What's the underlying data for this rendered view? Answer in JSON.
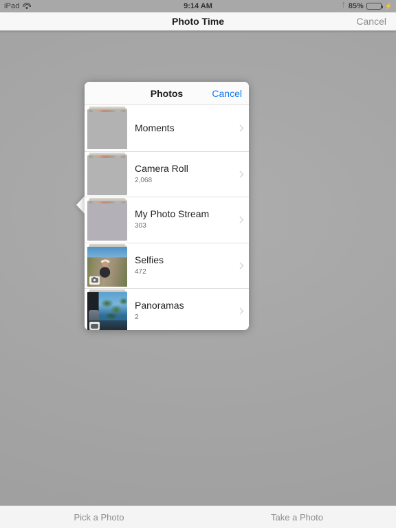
{
  "status_bar": {
    "device": "iPad",
    "wifi_icon": "wifi-icon",
    "time": "9:14 AM",
    "bluetooth_icon": "bluetooth-icon",
    "battery_percent": "85%",
    "battery_level": 85,
    "battery_fill_color": "#32d74b",
    "charging_icon": "lightning-bolt-icon"
  },
  "nav_bar": {
    "title": "Photo Time",
    "cancel_label": "Cancel"
  },
  "popover": {
    "title": "Photos",
    "cancel_label": "Cancel",
    "cancel_color": "#1277ec",
    "albums": [
      {
        "name": "Moments",
        "count": "",
        "thumb": "stacked-gray-thumbnail",
        "badge": ""
      },
      {
        "name": "Camera Roll",
        "count": "2,068",
        "thumb": "stacked-gray-thumbnail",
        "badge": ""
      },
      {
        "name": "My Photo Stream",
        "count": "303",
        "thumb": "stacked-purple-thumbnail",
        "badge": ""
      },
      {
        "name": "Selfies",
        "count": "472",
        "thumb": "selfie-photo-thumbnail",
        "badge": "camera-badge-icon"
      },
      {
        "name": "Panoramas",
        "count": "2",
        "thumb": "panorama-photo-thumbnail",
        "badge": "panorama-badge-icon"
      }
    ],
    "chevron_icon": "chevron-right-icon"
  },
  "bottom_toolbar": {
    "buttons": [
      {
        "label": "Pick a Photo"
      },
      {
        "label": "Take a Photo"
      }
    ]
  }
}
